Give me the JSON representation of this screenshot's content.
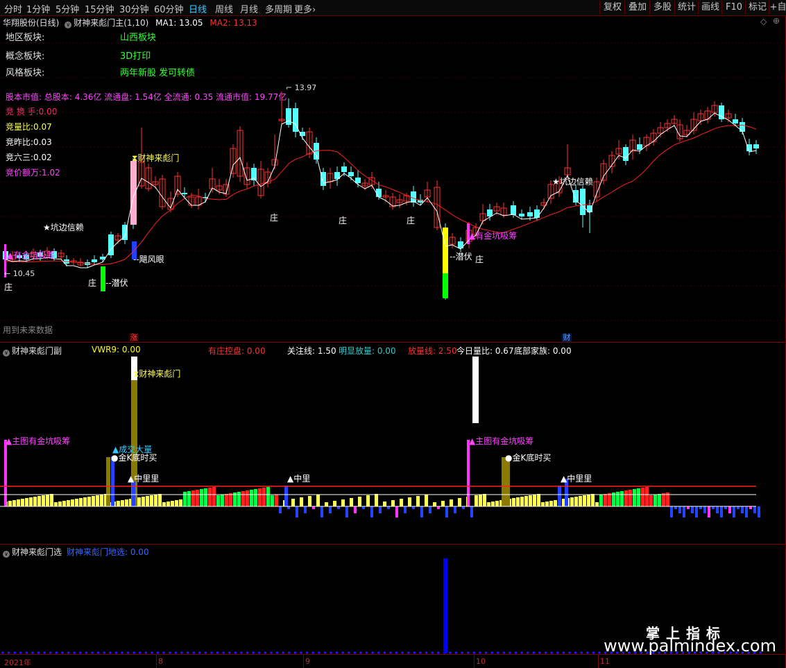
{
  "toolbar": {
    "periods": [
      "分时",
      "1分钟",
      "5分钟",
      "15分钟",
      "30分钟",
      "60分钟",
      "日线",
      "周线",
      "月线",
      "多周期",
      "更多"
    ],
    "active_period": "日线",
    "more_arrow": "›",
    "right_buttons": [
      "复权",
      "叠加",
      "多股",
      "统计",
      "画线",
      "F10",
      "标记",
      "+自选"
    ]
  },
  "main_panel": {
    "title": "华翔股份(日线)",
    "indicator": "财神来彪门主(1,10)",
    "ma1_label": "MA1: 13.05",
    "ma2_label": "MA2: 13.13",
    "info": [
      {
        "label": "地区板块:",
        "value": "山西板块"
      },
      {
        "label": "概念板块:",
        "value": "3D打印"
      },
      {
        "label": "风格板块:",
        "value": "两年新股 发可转债"
      }
    ],
    "capital_line": "股本市值: 总股本: 4.36亿 流通盘: 1.54亿 全流通: 0.35 流通市值: 19.77亿",
    "stats": [
      {
        "text": "竞 换 手:0.00",
        "color": "#ff2e6e"
      },
      {
        "text": "竞量比:0.07",
        "color": "#ffff55"
      },
      {
        "text": "竞昨比:0.03",
        "color": "#ffffff"
      },
      {
        "text": "竞六三:0.02",
        "color": "#ffffff"
      },
      {
        "text": "竞价额万:1.02",
        "color": "#ff44ff"
      }
    ],
    "high_label": "13.97",
    "low_label": "10.45",
    "future_data": "用到未来数据",
    "annotations": {
      "caishen": "财神来彪门",
      "kengbian1": "★坑边信赖",
      "kengbian2": "★坑边信赖",
      "youjin_main": "▲有金坑吸筹",
      "youjin_left": "▲有金坑吸筹",
      "qianfu1": "潜伏",
      "qianfu2": "潜伏",
      "jufengyan": "飓风眼",
      "zhuang": "庄"
    },
    "markers": {
      "zhang": "涨",
      "cai": "财"
    }
  },
  "sub_panel": {
    "title": "财神来彪门副",
    "fields": [
      {
        "text": "VWR9: 0.00",
        "color": "#ffff00"
      },
      {
        "text": "有庄控盘: 0.00",
        "color": "#ff3030"
      },
      {
        "text": "关注线: 1.50",
        "color": "#ffffff"
      },
      {
        "text": "明显放量: 0.00",
        "color": "#33cccc"
      },
      {
        "text": "放量线: 2.50",
        "color": "#ff3030"
      },
      {
        "text": "今日量比: 0.67",
        "color": "#ffffff"
      },
      {
        "text": "底部家族: 0.00",
        "color": "#ffffff"
      }
    ],
    "annotations": {
      "caishen": "财神来彪门",
      "main_keng1": "▲主图有金坑吸筹",
      "main_keng2": "▲主图有金坑吸筹",
      "chengjiao": "▲成交大量",
      "jink1": "●金K底时买",
      "jink2": "●金K底时买",
      "zhongli": "▲中里"
    }
  },
  "third_panel": {
    "title": "财神来彪门选",
    "field": "财神来彪门地选: 0.00"
  },
  "x_axis": [
    "2021年",
    "8",
    "9",
    "10",
    "11"
  ],
  "watermark": {
    "line1": "掌上指标",
    "line2": "www.palmindex.com"
  }
}
